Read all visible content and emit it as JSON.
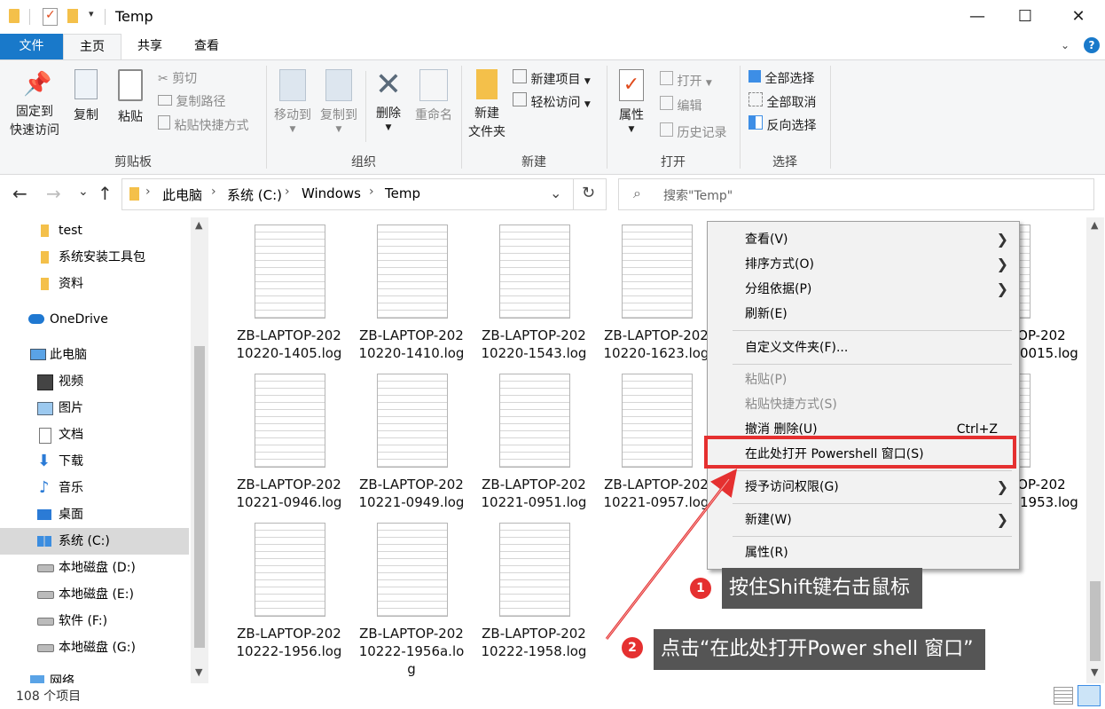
{
  "window": {
    "title": "Temp"
  },
  "tabs": [
    "文件",
    "主页",
    "共享",
    "查看"
  ],
  "ribbon": {
    "clipboard": {
      "label": "剪贴板",
      "pin": [
        "固定到",
        "快速访问"
      ],
      "copy": "复制",
      "paste": "粘贴",
      "cut": "剪切",
      "copy_path": "复制路径",
      "paste_shortcut": "粘贴快捷方式"
    },
    "organize": {
      "label": "组织",
      "move_to": "移动到",
      "copy_to": "复制到",
      "delete": "删除",
      "rename": "重命名"
    },
    "new": {
      "label": "新建",
      "new_folder": [
        "新建",
        "文件夹"
      ],
      "new_item": "新建项目",
      "easy_access": "轻松访问"
    },
    "open": {
      "label": "打开",
      "properties": "属性",
      "open": "打开",
      "edit": "编辑",
      "history": "历史记录"
    },
    "select": {
      "label": "选择",
      "select_all": "全部选择",
      "select_none": "全部取消",
      "invert": "反向选择"
    }
  },
  "address": {
    "path": [
      "此电脑",
      "系统 (C:)",
      "Windows",
      "Temp"
    ],
    "search_placeholder": "搜索\"Temp\""
  },
  "nav": [
    {
      "label": "test",
      "icon": "folder-icon"
    },
    {
      "label": "系统安装工具包",
      "icon": "folder-icon"
    },
    {
      "label": "资料",
      "icon": "folder-icon"
    },
    {
      "label": "OneDrive",
      "icon": "cloud-icon"
    },
    {
      "label": "此电脑",
      "icon": "computer-icon"
    },
    {
      "label": "视频",
      "icon": "video-icon"
    },
    {
      "label": "图片",
      "icon": "picture-icon"
    },
    {
      "label": "文档",
      "icon": "document-icon"
    },
    {
      "label": "下载",
      "icon": "download-icon"
    },
    {
      "label": "音乐",
      "icon": "music-icon"
    },
    {
      "label": "桌面",
      "icon": "desktop-icon"
    },
    {
      "label": "系统 (C:)",
      "icon": "windows-drive-icon"
    },
    {
      "label": "本地磁盘 (D:)",
      "icon": "drive-icon"
    },
    {
      "label": "本地磁盘 (E:)",
      "icon": "drive-icon"
    },
    {
      "label": "软件 (F:)",
      "icon": "drive-icon"
    },
    {
      "label": "本地磁盘 (G:)",
      "icon": "drive-icon"
    },
    {
      "label": "网络",
      "icon": "network-icon"
    }
  ],
  "files": [
    [
      "ZB-LAPTOP-202",
      "10220-1405.log"
    ],
    [
      "ZB-LAPTOP-202",
      "10220-1410.log"
    ],
    [
      "ZB-LAPTOP-202",
      "10220-1543.log"
    ],
    [
      "ZB-LAPTOP-202",
      "10220-1623.log"
    ],
    [
      "TOP-202",
      "0015.log"
    ],
    [
      "ZB-LAPTOP-202",
      "10221-0946.log"
    ],
    [
      "ZB-LAPTOP-202",
      "10221-0949.log"
    ],
    [
      "ZB-LAPTOP-202",
      "10221-0951.log"
    ],
    [
      "ZB-LAPTOP-202",
      "10221-0957.log"
    ],
    [
      "TOP-202",
      "1953.log"
    ],
    [
      "ZB-LAPTOP-202",
      "10222-1956.log"
    ],
    [
      "ZB-LAPTOP-202",
      "10222-1956a.lo",
      "g"
    ],
    [
      "ZB-LAPTOP-202",
      "10222-1958.log"
    ]
  ],
  "context_menu": [
    {
      "label": "查看(V)",
      "submenu": true
    },
    {
      "label": "排序方式(O)",
      "submenu": true
    },
    {
      "label": "分组依据(P)",
      "submenu": true
    },
    {
      "label": "刷新(E)"
    },
    {
      "label": "自定义文件夹(F)..."
    },
    {
      "label": "粘贴(P)",
      "disabled": true
    },
    {
      "label": "粘贴快捷方式(S)",
      "disabled": true
    },
    {
      "label": "撤消 删除(U)",
      "shortcut": "Ctrl+Z"
    },
    {
      "label": "在此处打开 Powershell 窗口(S)",
      "highlighted": true
    },
    {
      "label": "授予访问权限(G)",
      "submenu": true
    },
    {
      "label": "新建(W)",
      "submenu": true
    },
    {
      "label": "属性(R)"
    }
  ],
  "annotations": [
    {
      "num": "1",
      "text": "按住Shift键右击鼠标"
    },
    {
      "num": "2",
      "text": "点击“在此处打开Power shell 窗口”"
    }
  ],
  "status": {
    "count": "108 个项目"
  },
  "colors": {
    "accent": "#1979ca",
    "highlight_box": "#e53030",
    "callout_bg": "#555555"
  }
}
